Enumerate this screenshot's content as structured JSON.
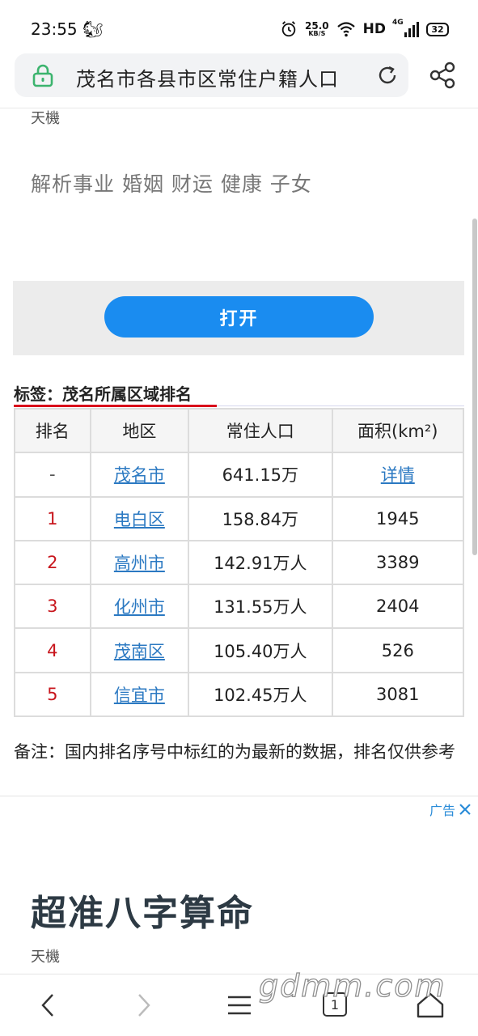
{
  "status_bar": {
    "time": "23:55",
    "app_icon": "🐿",
    "net_speed_value": "25.0",
    "net_speed_unit": "KB/S",
    "hd": "HD",
    "network_type": "4G",
    "battery": "32"
  },
  "address_bar": {
    "title": "茂名市各县市区常住户籍人口"
  },
  "ad_top": {
    "brand": "天機",
    "description": "解析事业 婚姻 财运 健康 子女",
    "open_button": "打开"
  },
  "tag": {
    "label": "标签：茂名所属区域排名"
  },
  "table": {
    "headers": [
      "排名",
      "地区",
      "常住人口",
      "面积(km²)"
    ],
    "rows": [
      {
        "rank": "-",
        "region": "茂名市",
        "population": "641.15万",
        "area": "详情"
      },
      {
        "rank": "1",
        "region": "电白区",
        "population": "158.84万",
        "area": "1945"
      },
      {
        "rank": "2",
        "region": "高州市",
        "population": "142.91万人",
        "area": "3389"
      },
      {
        "rank": "3",
        "region": "化州市",
        "population": "131.55万人",
        "area": "2404"
      },
      {
        "rank": "4",
        "region": "茂南区",
        "population": "105.40万人",
        "area": "526"
      },
      {
        "rank": "5",
        "region": "信宜市",
        "population": "102.45万人",
        "area": "3081"
      }
    ]
  },
  "note": "备注：国内排名序号中标红的为最新的数据，排名仅供参考",
  "ad_bottom": {
    "label": "广告",
    "title": "超准八字算命",
    "brand": "天機"
  },
  "bottom_nav": {
    "tab_count": "1"
  },
  "watermark": "gdmm.com",
  "colors": {
    "link": "#2b79c2",
    "rank_red": "#c8161d",
    "primary_button": "#1a8cf0",
    "tag_underline": "#d9001b",
    "lock_green": "#3cb46e",
    "ad_label": "#2b8cd8"
  }
}
